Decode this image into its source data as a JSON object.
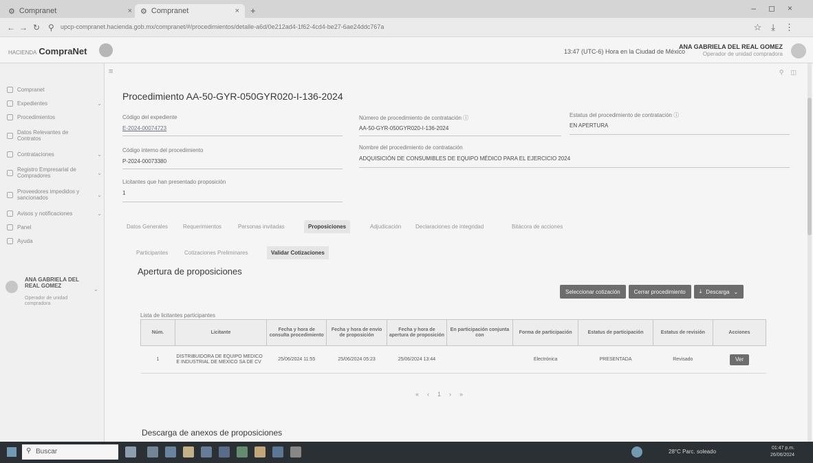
{
  "browser": {
    "tabs": [
      {
        "label": "Compranet"
      },
      {
        "label": "Compranet"
      }
    ],
    "url": "upcp-compranet.hacienda.gob.mx/compranet/#/procedimientos/detalle-a6d/0e212ad4-1f62-4cd4-be27-6ae24ddc767a"
  },
  "header": {
    "logo_prefix": "HACIENDA",
    "logo_text": "CompraNet",
    "clock": "13:47 (UTC-6) Hora en la Ciudad de México",
    "user_name": "ANA GABRIELA DEL REAL GOMEZ",
    "user_role": "Operador de unidad compradora"
  },
  "sidebar": {
    "items": [
      {
        "label": "Compranet",
        "chevron": ""
      },
      {
        "label": "Expedientes",
        "chevron": "⌄"
      },
      {
        "label": "Procedimientos",
        "chevron": ""
      },
      {
        "label": "Datos Relevantes de Contratos",
        "chevron": ""
      },
      {
        "label": "Contrataciones",
        "chevron": "⌄"
      },
      {
        "label": "Registro Empresarial de Compradores",
        "chevron": "⌄"
      },
      {
        "label": "Proveedores impedidos y sancionados",
        "chevron": "⌄"
      },
      {
        "label": "Avisos y notificaciones",
        "chevron": "⌄"
      },
      {
        "label": "Panel",
        "chevron": ""
      },
      {
        "label": "Ayuda",
        "chevron": ""
      }
    ],
    "user_name": "ANA GABRIELA DEL REAL GOMEZ",
    "user_role": "Operador de unidad compradora"
  },
  "main": {
    "title": "Procedimiento AA-50-GYR-050GYR020-I-136-2024",
    "fields": {
      "codigo_expediente": {
        "label": "Código del expediente",
        "value": "E-2024-00074723"
      },
      "numero_procedimiento": {
        "label": "Número de procedimiento de contratación ⓘ",
        "value": "AA-50-GYR-050GYR020-I-136-2024"
      },
      "estatus": {
        "label": "Estatus del procedimiento de contratación ⓘ",
        "value": "EN APERTURA"
      },
      "codigo_interno": {
        "label": "Código interno del procedimiento",
        "value": "P-2024-00073380"
      },
      "nombre": {
        "label": "Nombre del procedimiento de contratación",
        "value": "ADQUISICIÓN DE CONSUMIBLES DE EQUIPO MÉDICO PARA EL EJERCICIO 2024"
      },
      "licitantes": {
        "label": "Licitantes que han presentado proposición",
        "value": "1"
      }
    },
    "tabs": [
      {
        "label": "Datos Generales"
      },
      {
        "label": "Requerimientos"
      },
      {
        "label": "Personas invitadas"
      },
      {
        "label": "Proposiciones"
      },
      {
        "label": "Adjudicación"
      },
      {
        "label": "Declaraciones de integridad"
      },
      {
        "label": "Bitácora de acciones"
      }
    ],
    "subtabs": [
      {
        "label": "Participantes"
      },
      {
        "label": "Cotizaciones Preliminares"
      },
      {
        "label": "Validar Cotizaciones"
      }
    ],
    "section_title": "Apertura de proposiciones",
    "buttons": {
      "seleccionar": "Seleccionar cotización",
      "cerrar": "Cerrar procedimiento",
      "descarga": "Descarga"
    },
    "table_label": "Lista de licitantes participantes",
    "columns": [
      "Núm.",
      "Licitante",
      "Fecha y hora de consulta procedimiento",
      "Fecha y hora de envío de proposición",
      "Fecha y hora de apertura de proposición",
      "En participación conjunta con",
      "Forma de participación",
      "Estatus de participación",
      "Estatus de revisión",
      "Acciones"
    ],
    "rows": [
      {
        "num": "1",
        "licitante": "DISTRIBUIDORA DE EQUIPO MEDICO E INDUSTRIAL DE MEXICO SA DE CV",
        "consulta": "25/06/2024 11:55",
        "envio": "25/06/2024 05:23",
        "apertura": "25/06/2024 13:44",
        "conjunta": "",
        "forma": "Electrónica",
        "estatus": "PRESENTADA",
        "revision": "Revisado",
        "accion": "Ver"
      }
    ],
    "pager": {
      "current": "1"
    },
    "section2_title": "Descarga de anexos de proposiciones"
  },
  "taskbar": {
    "search_placeholder": "Buscar",
    "weather": "28°C Parc. soleado",
    "time": "01:47 p.m.",
    "date": "26/06/2024"
  }
}
